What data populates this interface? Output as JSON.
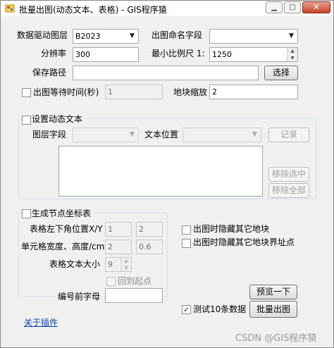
{
  "window": {
    "title": "批量出图(动态文本、表格) - GIS程序猿",
    "min_glyph": "▁",
    "max_glyph": "□",
    "close_glyph": "✕"
  },
  "form": {
    "layer_label": "数据驱动图层",
    "layer_value": "B2023",
    "name_field_label": "出图命名字段",
    "name_field_value": "",
    "resolution_label": "分辨率",
    "resolution_value": "300",
    "scale_label": "最小比例尺 1:",
    "scale_value": "1250",
    "save_path_label": "保存路径",
    "save_path_value": "",
    "choose_button": "选择",
    "wait_label": "出图等待时间(秒)",
    "wait_value": "1",
    "zoom_label": "地块缩放",
    "zoom_value": "2"
  },
  "dynamic_text": {
    "checkbox_label": "设置动态文本",
    "layer_field_label": "图层字段",
    "text_position_label": "文本位置",
    "record_button": "记录",
    "text_area_value": "",
    "remove_selected_button": "移除选中",
    "remove_all_button": "移除全部"
  },
  "coord_table": {
    "checkbox_label": "生成节点坐标表",
    "lower_left_label": "表格左下角位置X/Y",
    "lower_left_x": "1",
    "lower_left_y": "2",
    "cell_size_label": "单元格宽度、高度/cm",
    "cell_width": "2",
    "cell_height": "0.6",
    "font_size_label": "表格文本大小",
    "font_size_value": "9",
    "return_start_label": "回到起点",
    "prefix_label": "编号前字母",
    "prefix_value": ""
  },
  "options": {
    "hide_other_parcels": "出图时隐藏其它地块",
    "hide_other_boundary": "出图时隐藏其它地块界址点",
    "test_ten_label": "测试10条数据",
    "test_ten_checked_glyph": "✓"
  },
  "actions": {
    "preview_button": "预览一下",
    "batch_button": "批量出图",
    "about_link": "关于插件"
  },
  "watermark": "CSDN @GIS程序猿"
}
